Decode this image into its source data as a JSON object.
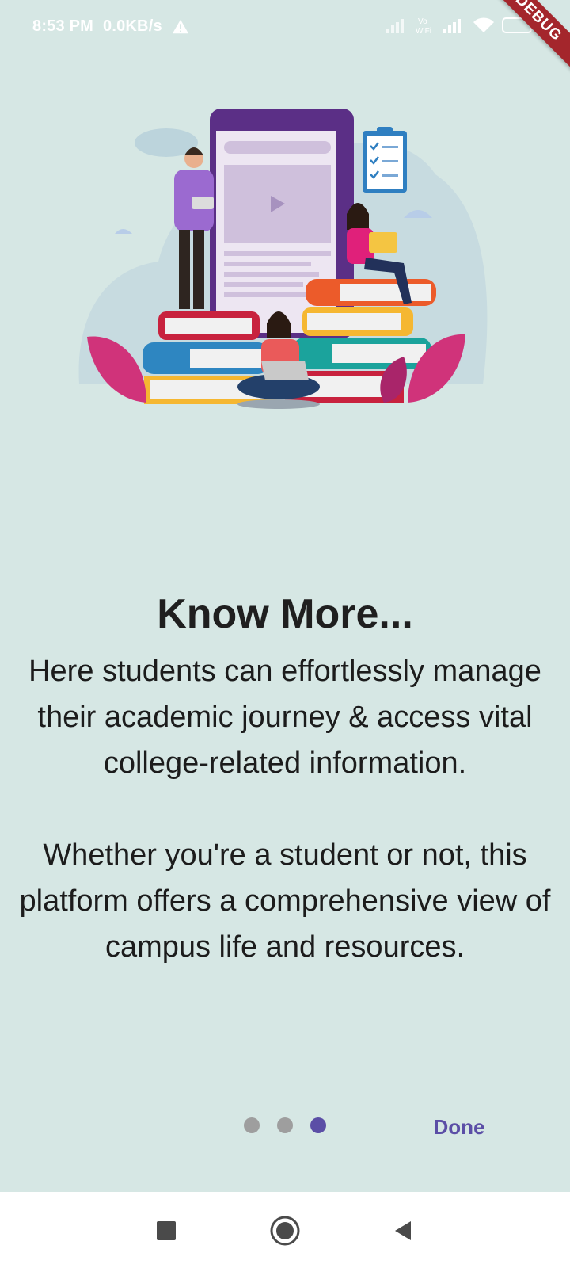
{
  "status_bar": {
    "time": "8:53 PM",
    "net_speed": "0.0KB/s",
    "icons": [
      "warning-icon",
      "signal-icon",
      "vowifi-icon",
      "signal-icon",
      "wifi-icon",
      "battery-icon"
    ],
    "vowifi_top": "Vo",
    "vowifi_bottom": "WiFi"
  },
  "debug_banner": {
    "label": "DEBUG",
    "color": "#a4262c"
  },
  "onboarding": {
    "illustration": "students-learning-illustration",
    "title": "Know More...",
    "paragraphs": [
      "Here students can effortlessly manage their academic journey & access vital college-related information.",
      "Whether you're a student or not, this platform offers a comprehensive view of campus life and resources."
    ],
    "page_indicator": {
      "total": 3,
      "current": 3
    },
    "done_label": "Done"
  },
  "colors": {
    "background": "#d6e7e4",
    "accent": "#5b4ea6",
    "dot_inactive": "#9e9e9e",
    "dot_active": "#5b4ea6"
  },
  "nav_bar": {
    "buttons": [
      "recents-square-icon",
      "home-circle-icon",
      "back-triangle-icon"
    ]
  }
}
